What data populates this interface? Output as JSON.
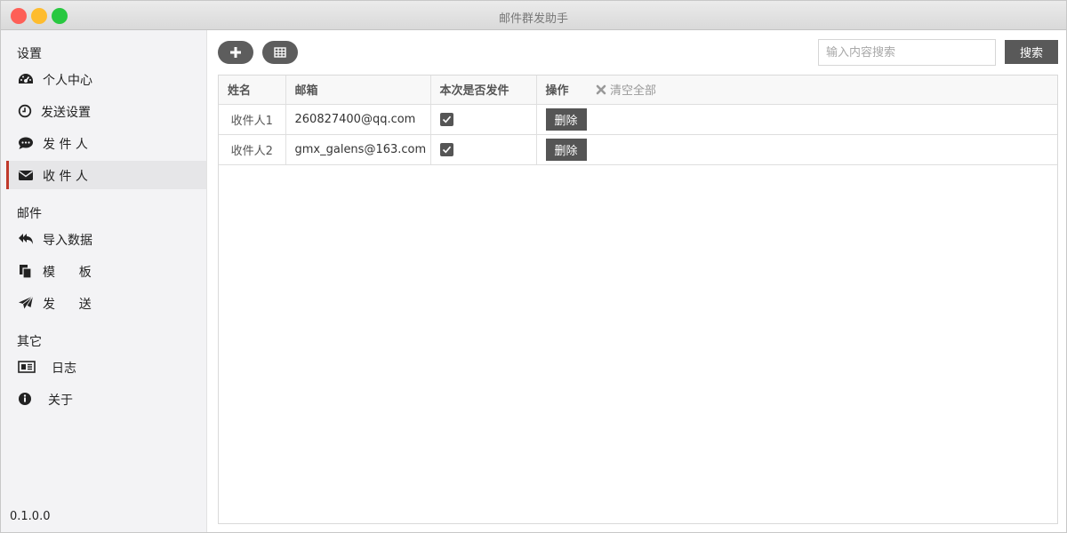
{
  "window": {
    "title": "邮件群发助手"
  },
  "sidebar": {
    "sections": [
      {
        "title": "设置"
      },
      {
        "title": "邮件"
      },
      {
        "title": "其它"
      }
    ],
    "items": [
      {
        "label": "个人中心",
        "icon": "dashboard-icon"
      },
      {
        "label": "发送设置",
        "icon": "clock-icon"
      },
      {
        "label": "发 件 人",
        "icon": "chat-icon"
      },
      {
        "label": "收 件 人",
        "icon": "envelope-icon"
      },
      {
        "label": "导入数据",
        "icon": "reply-all-icon"
      },
      {
        "label": "模      板",
        "icon": "copy-icon"
      },
      {
        "label": "发      送",
        "icon": "paper-plane-icon"
      },
      {
        "label": "日志",
        "icon": "newspaper-icon"
      },
      {
        "label": "关于",
        "icon": "info-icon"
      }
    ],
    "active_item": "收 件 人",
    "version": "0.1.0.0"
  },
  "toolbar": {
    "add_icon": "plus-icon",
    "table_icon": "table-icon",
    "search_placeholder": "输入内容搜索",
    "search_button": "搜索"
  },
  "table": {
    "headers": [
      "姓名",
      "邮箱",
      "本次是否发件",
      "操作"
    ],
    "clear_all": "清空全部",
    "rows": [
      {
        "name": "收件人1",
        "email": "260827400@qq.com",
        "send": true,
        "action": "删除"
      },
      {
        "name": "收件人2",
        "email": "gmx_galens@163.com",
        "send": true,
        "action": "删除"
      }
    ]
  },
  "colors": {
    "accent": "#c0392b",
    "button": "#595959",
    "sidebar_bg": "#f3f3f5"
  }
}
